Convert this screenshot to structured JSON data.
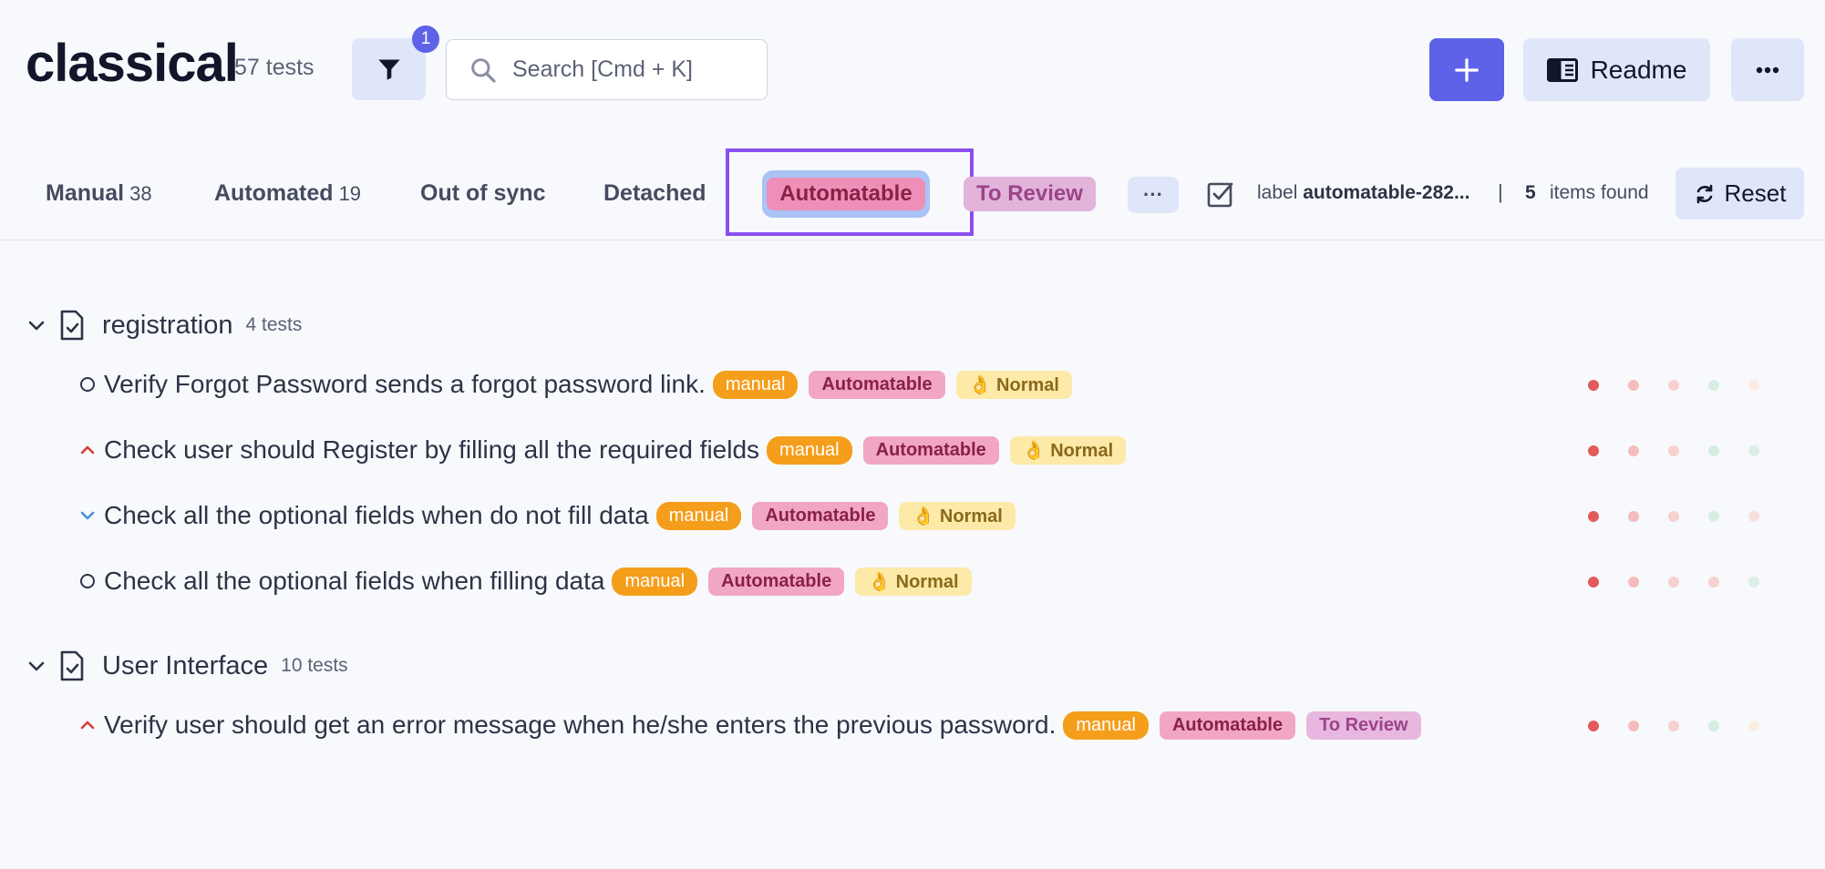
{
  "header": {
    "project_title": "classical",
    "project_count": "57 tests",
    "filter_badge": "1",
    "search_placeholder": "Search [Cmd + K]",
    "readme_label": "Readme"
  },
  "tabs": {
    "manual": {
      "label": "Manual",
      "count": "38"
    },
    "automated": {
      "label": "Automated",
      "count": "19"
    },
    "out_of_sync": "Out of sync",
    "detached": "Detached",
    "automatable": "Automatable",
    "to_review": "To Review",
    "more": "···"
  },
  "filter_info": {
    "prefix": "label",
    "value": "automatable-282...",
    "separator": "|",
    "found_count": "5",
    "found_text": "items found",
    "reset_label": "Reset"
  },
  "suites": [
    {
      "title": "registration",
      "count": "4 tests",
      "tests": [
        {
          "title": "Verify Forgot Password sends a forgot password link.",
          "priority": "none",
          "tags": [
            "manual",
            "Automatable",
            "👌 Normal"
          ]
        },
        {
          "title": "Check user should Register by filling all the required fields",
          "priority": "high",
          "tags": [
            "manual",
            "Automatable",
            "👌 Normal"
          ]
        },
        {
          "title": "Check all the optional fields when do not fill data",
          "priority": "low",
          "tags": [
            "manual",
            "Automatable",
            "👌 Normal"
          ]
        },
        {
          "title": "Check all the optional fields when filling data",
          "priority": "none",
          "tags": [
            "manual",
            "Automatable",
            "👌 Normal"
          ]
        }
      ]
    },
    {
      "title": "User Interface",
      "count": "10 tests",
      "tests": [
        {
          "title": "Verify user should get an error message when he/she enters the previous password.",
          "priority": "high",
          "tags": [
            "manual",
            "Automatable",
            "To Review"
          ]
        }
      ]
    }
  ],
  "colors": {
    "accent": "#5d62e9",
    "highlight_border": "#8b4ff0",
    "manual_tag": "#f59e1b",
    "automatable_tag": "#f1a6c5",
    "normal_tag": "#fde9a8",
    "review_tag": "#e8b7df",
    "priority_high": "#d93b3b",
    "priority_low": "#4a90d9"
  },
  "icons": [
    "filter-icon",
    "search-icon",
    "plus-icon",
    "book-icon",
    "more-icon",
    "checklist-icon",
    "refresh-icon",
    "chevron-down-icon",
    "file-check-icon"
  ]
}
